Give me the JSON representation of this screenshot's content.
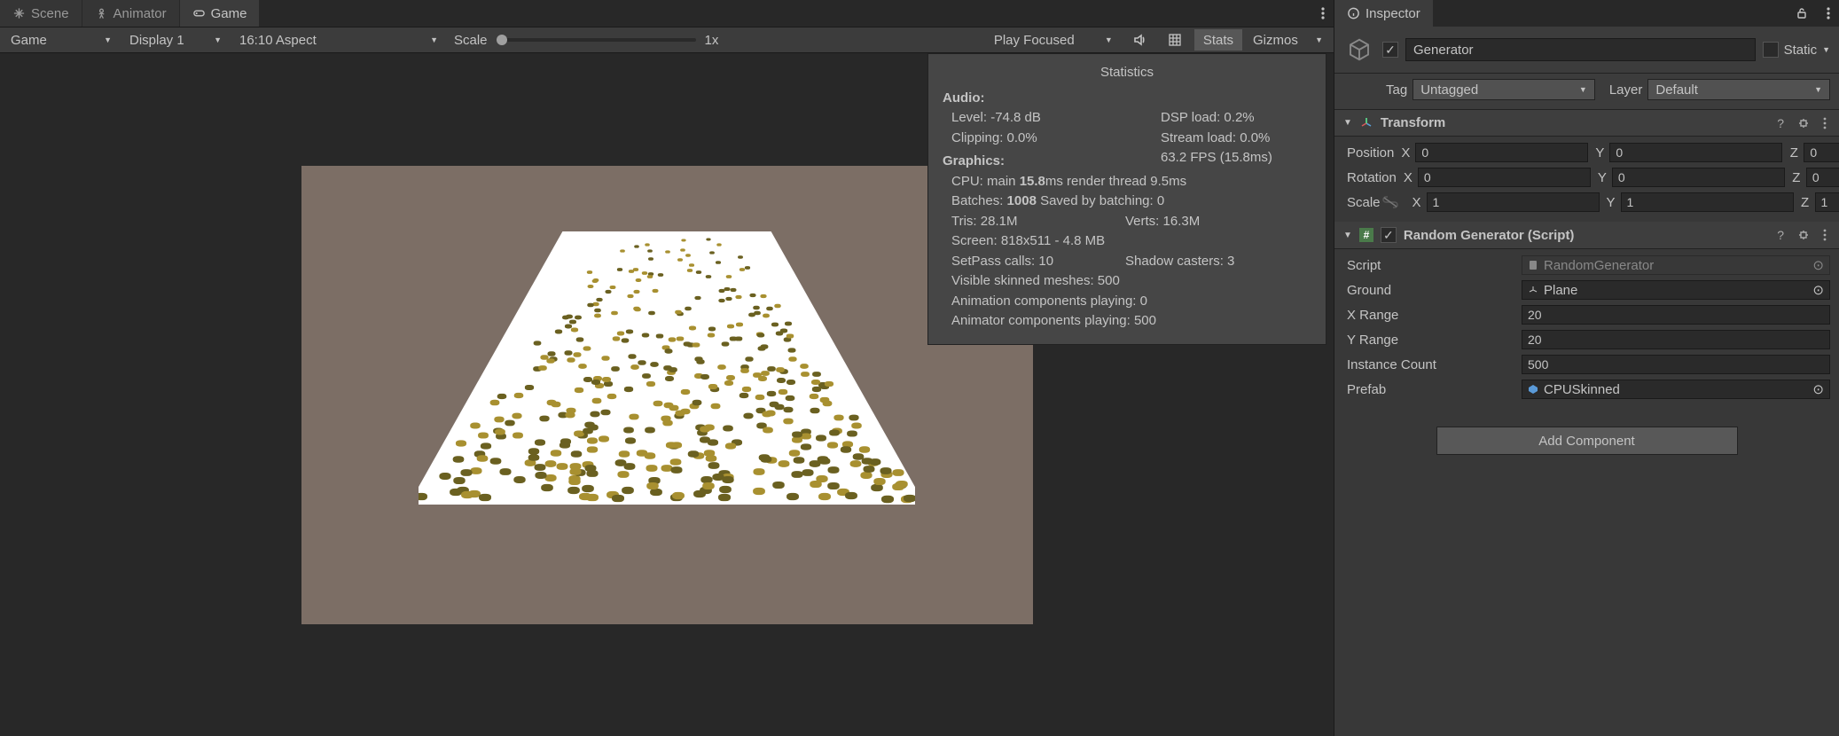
{
  "tabs": {
    "scene": "Scene",
    "animator": "Animator",
    "game": "Game",
    "inspector": "Inspector"
  },
  "toolbar": {
    "camera": "Game",
    "display": "Display 1",
    "aspect": "16:10 Aspect",
    "scale_label": "Scale",
    "scale_value": "1x",
    "play_mode": "Play Focused",
    "stats": "Stats",
    "gizmos": "Gizmos"
  },
  "stats": {
    "title": "Statistics",
    "audio_hdr": "Audio:",
    "audio_level": "Level: -74.8 dB",
    "audio_clipping": "Clipping: 0.0%",
    "dsp": "DSP load: 0.2%",
    "stream": "Stream load: 0.0%",
    "graphics_hdr": "Graphics:",
    "fps": "63.2 FPS (15.8ms)",
    "cpu_pre": "CPU: main ",
    "cpu_main": "15.8",
    "cpu_mid": "ms  render thread 9.5ms",
    "batches_pre": "Batches: ",
    "batches": "1008",
    "batches_post": "  Saved by batching: 0",
    "tris": "Tris: 28.1M",
    "verts": "Verts: 16.3M",
    "screen": "Screen: 818x511 - 4.8 MB",
    "setpass": "SetPass calls: 10",
    "shadow": "Shadow casters: 3",
    "skinned": "Visible skinned meshes: 500",
    "anim": "Animation components playing: 0",
    "animator": "Animator components playing: 500"
  },
  "inspector": {
    "name": "Generator",
    "static": "Static",
    "tag_label": "Tag",
    "tag_value": "Untagged",
    "layer_label": "Layer",
    "layer_value": "Default",
    "transform": {
      "title": "Transform",
      "pos": "Position",
      "rot": "Rotation",
      "scale": "Scale",
      "px": "0",
      "py": "0",
      "pz": "0",
      "rx": "0",
      "ry": "0",
      "rz": "0",
      "sx": "1",
      "sy": "1",
      "sz": "1"
    },
    "rg": {
      "title": "Random Generator (Script)",
      "script_l": "Script",
      "script_v": "RandomGenerator",
      "ground_l": "Ground",
      "ground_v": "Plane",
      "xrange_l": "X Range",
      "xrange_v": "20",
      "yrange_l": "Y Range",
      "yrange_v": "20",
      "count_l": "Instance Count",
      "count_v": "500",
      "prefab_l": "Prefab",
      "prefab_v": "CPUSkinned"
    },
    "add_component": "Add Component"
  }
}
